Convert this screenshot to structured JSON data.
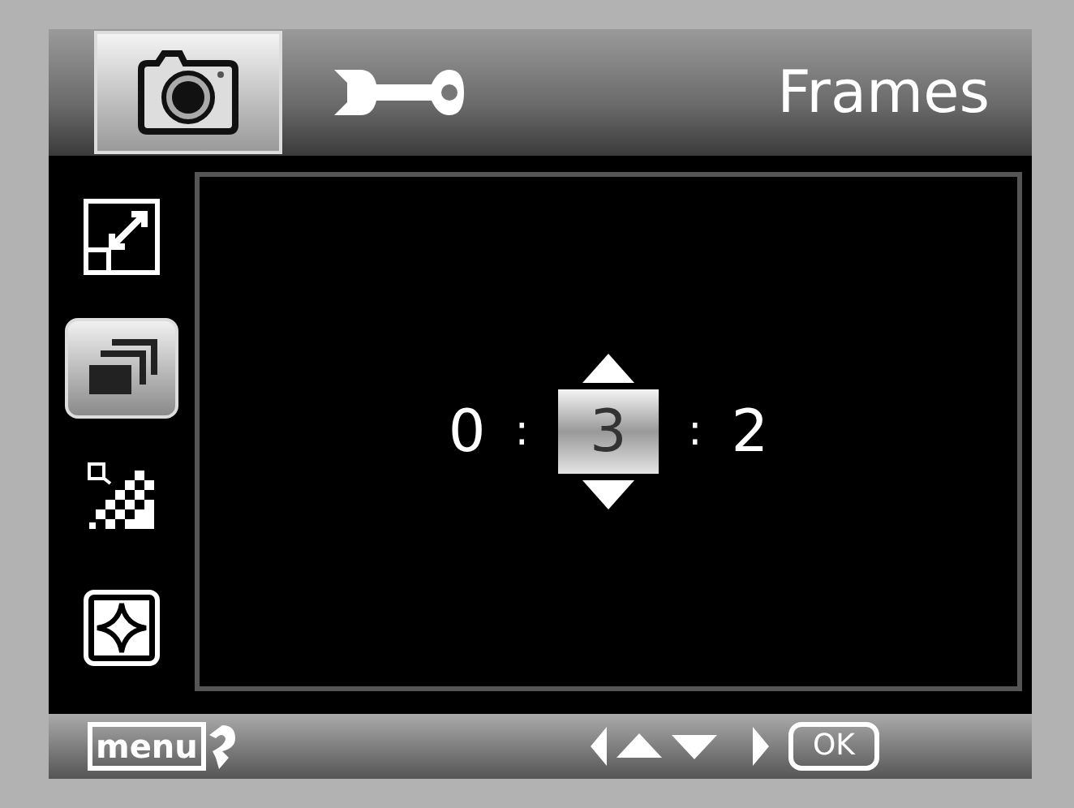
{
  "tabs": [
    {
      "kind": "camera",
      "selected": true
    },
    {
      "kind": "wrench",
      "selected": false
    }
  ],
  "title": "Frames",
  "sidebar": {
    "items": [
      {
        "kind": "resize",
        "selected": false
      },
      {
        "kind": "frames",
        "selected": true
      },
      {
        "kind": "quality",
        "selected": false
      },
      {
        "kind": "sharpness",
        "selected": false
      }
    ]
  },
  "selector": {
    "fields": [
      {
        "value": "0",
        "selected": false
      },
      {
        "value": "3",
        "selected": true
      },
      {
        "value": "2",
        "selected": false
      }
    ],
    "separators": [
      ":",
      ":"
    ]
  },
  "footer": {
    "menu_label": "menu",
    "ok_label": "OK"
  }
}
